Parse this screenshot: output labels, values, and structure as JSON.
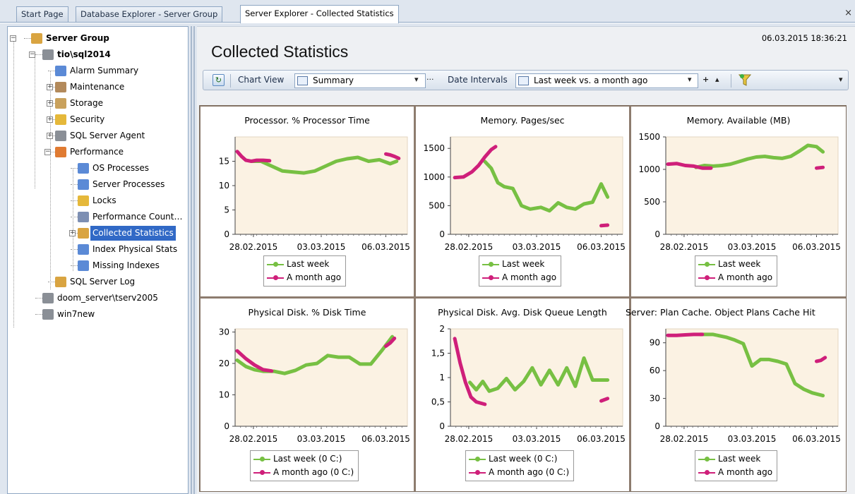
{
  "tabs": [
    {
      "label": "Start Page",
      "active": false
    },
    {
      "label": "Database Explorer - Server Group",
      "active": false
    },
    {
      "label": "Server Explorer - Collected Statistics",
      "active": true
    }
  ],
  "close_symbol": "×",
  "tree": {
    "items": [
      {
        "label": "Server Group",
        "icon": "server-group-icon"
      },
      {
        "label": "tio\\sql2014",
        "icon": "server-icon"
      },
      {
        "label": "Alarm Summary",
        "icon": "alarm-summary-icon"
      },
      {
        "label": "Maintenance",
        "icon": "maintenance-icon"
      },
      {
        "label": "Storage",
        "icon": "storage-icon"
      },
      {
        "label": "Security",
        "icon": "security-key-icon"
      },
      {
        "label": "SQL Server Agent",
        "icon": "sql-agent-icon"
      },
      {
        "label": "Performance",
        "icon": "performance-icon"
      },
      {
        "label": "OS Processes",
        "icon": "os-processes-icon"
      },
      {
        "label": "Server Processes",
        "icon": "server-processes-icon"
      },
      {
        "label": "Locks",
        "icon": "lock-icon"
      },
      {
        "label": "Performance Count…",
        "icon": "performance-counters-icon"
      },
      {
        "label": "Collected Statistics",
        "icon": "collected-statistics-icon"
      },
      {
        "label": "Index Physical Stats",
        "icon": "index-stats-icon"
      },
      {
        "label": "Missing Indexes",
        "icon": "missing-indexes-icon"
      },
      {
        "label": "SQL Server Log",
        "icon": "server-log-icon"
      },
      {
        "label": "doom_server\\tserv2005",
        "icon": "server-warning-icon"
      },
      {
        "label": "win7new",
        "icon": "server-warning-icon"
      }
    ],
    "selected": "Collected Statistics"
  },
  "main": {
    "timestamp": "06.03.2015 18:36:21",
    "title": "Collected Statistics"
  },
  "toolbar": {
    "chart_view_label": "Chart View",
    "chart_view_value": "Summary",
    "date_intervals_label": "Date Intervals",
    "date_intervals_value": "Last week vs. a month ago",
    "dropdown_glyph": "▾",
    "more_glyph": "···",
    "add_glyph": "+",
    "up_glyph": "▴",
    "refresh_glyph": "↻"
  },
  "colors": {
    "last_week": "#77c043",
    "month_ago": "#cf1f7a",
    "plot_bg": "#fbf2e3"
  },
  "chart_data": [
    {
      "type": "line",
      "title": "Processor. % Processor Time",
      "xticks": [
        "28.02.2015",
        "03.03.2015",
        "06.03.2015"
      ],
      "x_range": [
        "27.02.2015",
        "07.03.2015"
      ],
      "ylim": [
        0,
        20
      ],
      "yticks": [
        "0",
        "5",
        "10",
        "15"
      ],
      "series": [
        {
          "name": "Last week",
          "color": "#77c043",
          "x": [
            0.75,
            1.2,
            1.7,
            2.2,
            2.7,
            3.2,
            3.7,
            4.2,
            4.7,
            5.2,
            5.7,
            6.2,
            6.7,
            7.2,
            7.5
          ],
          "values": [
            15,
            15,
            14,
            13,
            12.8,
            12.6,
            13,
            14,
            15,
            15.5,
            15.8,
            15,
            15.3,
            14.5,
            15
          ]
        },
        {
          "name": "A month ago",
          "color": "#cf1f7a",
          "x": [
            0.1,
            0.3,
            0.5,
            0.75,
            1.0,
            1.3,
            1.6
          ],
          "values": [
            17,
            16,
            15.2,
            15.0,
            15.2,
            15.2,
            15.1
          ]
        },
        {
          "name": "A month ago",
          "color": "#cf1f7a",
          "x": [
            7.0,
            7.2,
            7.4,
            7.6
          ],
          "values": [
            16.5,
            16.3,
            16,
            15.6
          ]
        }
      ],
      "legend": [
        "Last week",
        "A month ago"
      ]
    },
    {
      "type": "line",
      "title": "Memory. Pages/sec",
      "xticks": [
        "28.02.2015",
        "03.03.2015",
        "06.03.2015"
      ],
      "x_range": [
        "27.02.2015",
        "07.03.2015"
      ],
      "ylim": [
        0,
        1700
      ],
      "yticks": [
        "0",
        "500",
        "1000",
        "1500"
      ],
      "series": [
        {
          "name": "Last week",
          "color": "#77c043",
          "x": [
            1.6,
            1.9,
            2.2,
            2.5,
            2.9,
            3.3,
            3.7,
            4.2,
            4.6,
            5.0,
            5.4,
            5.8,
            6.2,
            6.6,
            7.0,
            7.3
          ],
          "values": [
            1270,
            1150,
            900,
            830,
            800,
            500,
            440,
            470,
            410,
            550,
            470,
            440,
            530,
            560,
            880,
            650
          ]
        },
        {
          "name": "A month ago",
          "color": "#cf1f7a",
          "x": [
            0.2,
            0.6,
            1.0,
            1.3,
            1.6,
            1.9,
            2.1
          ],
          "values": [
            990,
            1000,
            1090,
            1200,
            1350,
            1480,
            1530
          ]
        },
        {
          "name": "A month ago",
          "color": "#cf1f7a",
          "x": [
            7.0,
            7.3
          ],
          "values": [
            150,
            160
          ]
        }
      ],
      "legend": [
        "Last week",
        "A month ago"
      ]
    },
    {
      "type": "line",
      "title": "Memory. Available (MB)",
      "xticks": [
        "28.02.2015",
        "03.03.2015",
        "06.03.2015"
      ],
      "x_range": [
        "27.02.2015",
        "07.03.2015"
      ],
      "ylim": [
        0,
        1500
      ],
      "yticks": [
        "0",
        "500",
        "1000",
        "1500"
      ],
      "series": [
        {
          "name": "Last week",
          "color": "#77c043",
          "x": [
            1.4,
            1.8,
            2.2,
            2.6,
            3.0,
            3.4,
            3.8,
            4.2,
            4.6,
            5.0,
            5.4,
            5.8,
            6.2,
            6.6,
            7.0,
            7.3
          ],
          "values": [
            1030,
            1060,
            1050,
            1060,
            1080,
            1120,
            1160,
            1190,
            1200,
            1180,
            1170,
            1200,
            1280,
            1370,
            1350,
            1270
          ]
        },
        {
          "name": "A month ago",
          "color": "#cf1f7a",
          "x": [
            0.1,
            0.5,
            0.9,
            1.3,
            1.7,
            2.1
          ],
          "values": [
            1080,
            1090,
            1060,
            1050,
            1020,
            1020
          ]
        },
        {
          "name": "A month ago",
          "color": "#cf1f7a",
          "x": [
            7.0,
            7.3
          ],
          "values": [
            1020,
            1030
          ]
        }
      ],
      "legend": [
        "Last week",
        "A month ago"
      ]
    },
    {
      "type": "line",
      "title": "Physical Disk. % Disk Time",
      "xticks": [
        "28.02.2015",
        "03.03.2015",
        "06.03.2015"
      ],
      "x_range": [
        "27.02.2015",
        "07.03.2015"
      ],
      "ylim": [
        0,
        31
      ],
      "yticks": [
        "0",
        "10",
        "20",
        "30"
      ],
      "series": [
        {
          "name": "Last week (0 C:)",
          "color": "#77c043",
          "x": [
            0.1,
            0.5,
            0.9,
            1.3,
            1.8,
            2.3,
            2.8,
            3.3,
            3.8,
            4.3,
            4.8,
            5.3,
            5.8,
            6.3,
            6.8,
            7.3
          ],
          "values": [
            21,
            19,
            18,
            17.5,
            17.5,
            16.8,
            17.8,
            19.5,
            20,
            22.5,
            22,
            22,
            19.8,
            19.8,
            24,
            28.5
          ]
        },
        {
          "name": "A month ago (0 C:)",
          "color": "#cf1f7a",
          "x": [
            0.1,
            0.5,
            0.9,
            1.3,
            1.7
          ],
          "values": [
            24,
            21.5,
            19.5,
            18,
            17.6
          ]
        },
        {
          "name": "A month ago (0 C:)",
          "color": "#cf1f7a",
          "x": [
            7.0,
            7.2,
            7.4
          ],
          "values": [
            25.5,
            26.5,
            28
          ]
        }
      ],
      "legend": [
        "Last week (0 C:)",
        "A month ago (0 C:)"
      ]
    },
    {
      "type": "line",
      "title": "Physical Disk. Avg. Disk Queue Length",
      "xticks": [
        "28.02.2015",
        "03.03.2015",
        "06.03.2015"
      ],
      "x_range": [
        "27.02.2015",
        "07.03.2015"
      ],
      "ylim": [
        0,
        2
      ],
      "yticks": [
        "0",
        "0,5",
        "1",
        "1,5",
        "2"
      ],
      "series": [
        {
          "name": "Last week (0 C:)",
          "color": "#77c043",
          "x": [
            0.9,
            1.2,
            1.5,
            1.8,
            2.2,
            2.6,
            3.0,
            3.4,
            3.8,
            4.2,
            4.6,
            5.0,
            5.4,
            5.8,
            6.2,
            6.6,
            7.0,
            7.3
          ],
          "values": [
            0.9,
            0.75,
            0.92,
            0.72,
            0.78,
            0.98,
            0.75,
            0.92,
            1.2,
            0.85,
            1.15,
            0.85,
            1.2,
            0.82,
            1.4,
            0.95,
            0.95,
            0.95
          ]
        },
        {
          "name": "A month ago (0 C:)",
          "color": "#cf1f7a",
          "x": [
            0.2,
            0.45,
            0.7,
            0.95,
            1.2,
            1.6
          ],
          "values": [
            1.8,
            1.3,
            0.9,
            0.6,
            0.5,
            0.45
          ]
        },
        {
          "name": "A month ago (0 C:)",
          "color": "#cf1f7a",
          "x": [
            7.0,
            7.3
          ],
          "values": [
            0.52,
            0.57
          ]
        }
      ],
      "legend": [
        "Last week (0 C:)",
        "A month ago (0 C:)"
      ]
    },
    {
      "type": "line",
      "title": "Server: Plan Cache. Object Plans Cache Hit",
      "xticks": [
        "28.02.2015",
        "03.03.2015",
        "06.03.2015"
      ],
      "x_range": [
        "27.02.2015",
        "07.03.2015"
      ],
      "ylim": [
        0,
        105
      ],
      "yticks": [
        "0",
        "30",
        "60",
        "90"
      ],
      "series": [
        {
          "name": "Last week",
          "color": "#77c043",
          "x": [
            1.6,
            2.2,
            2.8,
            3.2,
            3.6,
            4.0,
            4.4,
            4.8,
            5.2,
            5.6,
            6.0,
            6.4,
            6.8,
            7.3
          ],
          "values": [
            99,
            99,
            96,
            93,
            89,
            65,
            72,
            72,
            70,
            67,
            46,
            40,
            36,
            33
          ]
        },
        {
          "name": "A month ago",
          "color": "#cf1f7a",
          "x": [
            0.1,
            0.5,
            0.9,
            1.3,
            1.7
          ],
          "values": [
            98,
            98,
            98.5,
            99,
            99
          ]
        },
        {
          "name": "A month ago",
          "color": "#cf1f7a",
          "x": [
            7.0,
            7.2,
            7.4
          ],
          "values": [
            70,
            71,
            74
          ]
        }
      ],
      "legend": [
        "Last week",
        "A month ago"
      ]
    }
  ]
}
